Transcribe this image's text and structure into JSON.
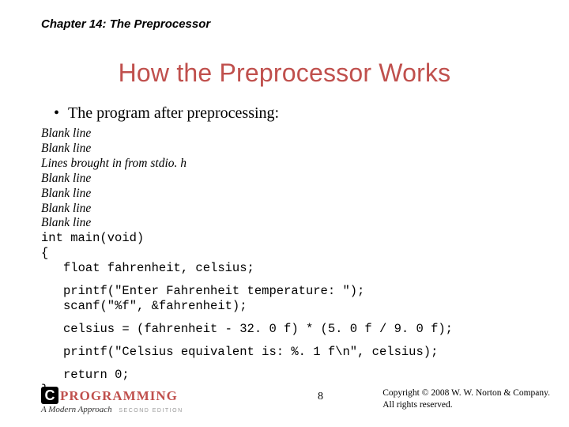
{
  "chapter": "Chapter 14: The Preprocessor",
  "title": "How the Preprocessor Works",
  "bullet": "The program after preprocessing:",
  "code": {
    "l1": "Blank line",
    "l2": "Blank line",
    "l3": "Lines brought in from stdio. h",
    "l4": "Blank line",
    "l5": "Blank line",
    "l6": "Blank line",
    "l7": "Blank line",
    "l8": "int main(void)",
    "l9": "{",
    "l10": "float fahrenheit, celsius;",
    "l11": "printf(\"Enter Fahrenheit temperature: \");",
    "l12": "scanf(\"%f\", &fahrenheit);",
    "l13": "celsius = (fahrenheit - 32. 0 f) * (5. 0 f / 9. 0 f);",
    "l14": "printf(\"Celsius equivalent is: %. 1 f\\n\", celsius);",
    "l15": "return 0;",
    "l16": "}"
  },
  "logo": {
    "c": "C",
    "prog": "PROGRAMMING",
    "sub": "A Modern Approach",
    "ed": "SECOND EDITION"
  },
  "pagenum": "8",
  "copyright": {
    "line1": "Copyright © 2008 W. W. Norton & Company.",
    "line2": "All rights reserved."
  }
}
